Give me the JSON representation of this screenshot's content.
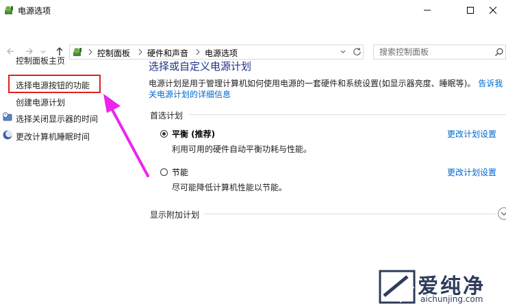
{
  "window": {
    "title": "电源选项"
  },
  "address": {
    "breadcrumbs": [
      "控制面板",
      "硬件和声音",
      "电源选项"
    ]
  },
  "search": {
    "placeholder": "搜索控制面板"
  },
  "sidebar": {
    "items": [
      {
        "label": "控制面板主页"
      },
      {
        "label": "选择电源按钮的功能"
      },
      {
        "label": "创建电源计划"
      },
      {
        "label": "选择关闭显示器的时间"
      },
      {
        "label": "更改计算机睡眠时间"
      }
    ]
  },
  "main": {
    "title": "选择或自定义电源计划",
    "description_line1": "电源计划是用于管理计算机如何使用电源的一套硬件和系统设置(如显示器亮度、睡眠等)。",
    "description_link1": "告诉我",
    "description_link2": "关电源计划的详细信息",
    "preferred_heading": "首选计划",
    "plans": [
      {
        "name": "平衡 (推荐)",
        "desc": "利用可用的硬件自动平衡功耗与性能。",
        "link": "更改计划设置",
        "selected": true
      },
      {
        "name": "节能",
        "desc": "尽可能降低计算机性能以节能。",
        "link": "更改计划设置",
        "selected": false
      }
    ],
    "additional_heading": "显示附加计划"
  },
  "watermark": {
    "brand": "爱纯净",
    "url": "aichunjing.com"
  },
  "colors": {
    "highlight": "#e02020",
    "arrow": "#ee22ee",
    "link": "#0066cc",
    "title": "#1e3287"
  }
}
